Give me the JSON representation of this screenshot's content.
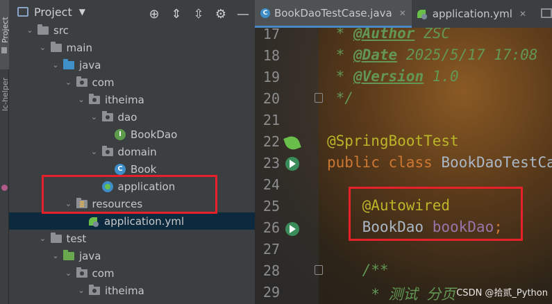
{
  "tool_strip": {
    "project_tab": "Project",
    "helper_tab": "lc-helper"
  },
  "project_panel": {
    "title": "Project",
    "header_icons": [
      "target-icon",
      "expand-icon",
      "collapse-icon",
      "gear-icon",
      "minimize-icon"
    ],
    "tree": [
      {
        "label": "src",
        "icon": "folder-grey",
        "indent": 0,
        "expanded": true
      },
      {
        "label": "main",
        "icon": "folder-grey",
        "indent": 1,
        "expanded": true
      },
      {
        "label": "java",
        "icon": "folder-blue",
        "indent": 2,
        "expanded": true
      },
      {
        "label": "com",
        "icon": "package",
        "indent": 3,
        "expanded": true
      },
      {
        "label": "itheima",
        "icon": "package",
        "indent": 4,
        "expanded": true
      },
      {
        "label": "dao",
        "icon": "package",
        "indent": 5,
        "expanded": true
      },
      {
        "label": "BookDao",
        "icon": "interface",
        "indent": 6,
        "expanded": null
      },
      {
        "label": "domain",
        "icon": "package",
        "indent": 5,
        "expanded": true
      },
      {
        "label": "Book",
        "icon": "class",
        "indent": 6,
        "expanded": null
      },
      {
        "label": "application",
        "icon": "spring-app",
        "indent": 5,
        "expanded": null
      },
      {
        "label": "resources",
        "icon": "resources",
        "indent": 3,
        "expanded": true
      },
      {
        "label": "application.yml",
        "icon": "yml",
        "indent": 4,
        "expanded": null,
        "selected": true
      },
      {
        "label": "test",
        "icon": "folder-grey",
        "indent": 1,
        "expanded": true
      },
      {
        "label": "java",
        "icon": "folder-green",
        "indent": 2,
        "expanded": true
      },
      {
        "label": "com",
        "icon": "package",
        "indent": 3,
        "expanded": true
      },
      {
        "label": "itheima",
        "icon": "package",
        "indent": 4,
        "expanded": true
      }
    ]
  },
  "editor": {
    "tabs": [
      {
        "label": "BookDaoTestCase.java",
        "active": true
      },
      {
        "label": "application.yml",
        "active": false
      }
    ],
    "lines": [
      {
        "n": "17",
        "tokens": [
          {
            "t": " * ",
            "c": "doc"
          },
          {
            "t": "@Author",
            "c": "tag"
          },
          {
            "t": " ZSC",
            "c": "doc"
          }
        ]
      },
      {
        "n": "18",
        "tokens": [
          {
            "t": " * ",
            "c": "doc"
          },
          {
            "t": "@Date",
            "c": "tag"
          },
          {
            "t": " 2025/5/17 17:08",
            "c": "doc"
          }
        ]
      },
      {
        "n": "19",
        "tokens": [
          {
            "t": " * ",
            "c": "doc"
          },
          {
            "t": "@Version",
            "c": "tag"
          },
          {
            "t": " 1.0",
            "c": "doc"
          }
        ]
      },
      {
        "n": "20",
        "tokens": [
          {
            "t": " */",
            "c": "doc"
          }
        ]
      },
      {
        "n": "21",
        "tokens": []
      },
      {
        "n": "22",
        "tokens": [
          {
            "t": "@SpringBootTest",
            "c": "ann"
          }
        ]
      },
      {
        "n": "23",
        "tokens": [
          {
            "t": "public ",
            "c": "kw"
          },
          {
            "t": "class ",
            "c": "kw"
          },
          {
            "t": "BookDaoTestCase",
            "c": "plain"
          }
        ]
      },
      {
        "n": "24",
        "tokens": []
      },
      {
        "n": "25",
        "tokens": [
          {
            "t": "    @Autowired",
            "c": "ann"
          }
        ]
      },
      {
        "n": "26",
        "tokens": [
          {
            "t": "    BookDao ",
            "c": "plain"
          },
          {
            "t": "bookDao",
            "c": "field"
          },
          {
            "t": ";",
            "c": "kw"
          }
        ]
      },
      {
        "n": "27",
        "tokens": []
      },
      {
        "n": "28",
        "tokens": [
          {
            "t": "    /**",
            "c": "doc"
          }
        ]
      },
      {
        "n": "29",
        "tokens": [
          {
            "t": "     * 测试 分页",
            "c": "doc"
          }
        ]
      }
    ],
    "watermark": "CSDN @拾贰_Python"
  }
}
